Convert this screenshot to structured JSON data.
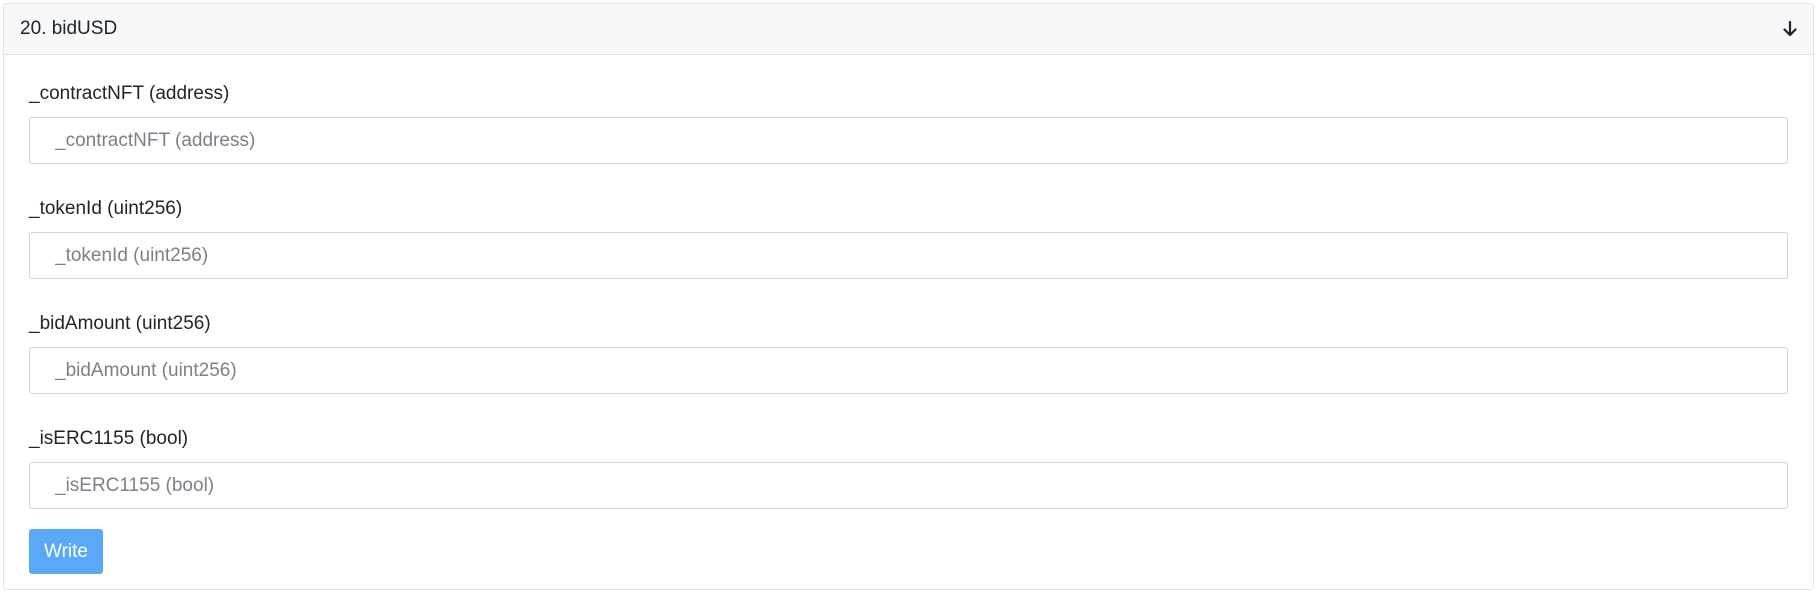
{
  "method": {
    "title": "20. bidUSD",
    "expand_icon": "arrow-down-icon"
  },
  "fields": [
    {
      "label": "_contractNFT (address)",
      "placeholder": "_contractNFT (address)",
      "value": ""
    },
    {
      "label": "_tokenId (uint256)",
      "placeholder": "_tokenId (uint256)",
      "value": ""
    },
    {
      "label": "_bidAmount (uint256)",
      "placeholder": "_bidAmount (uint256)",
      "value": ""
    },
    {
      "label": "_isERC1155 (bool)",
      "placeholder": "_isERC1155 (bool)",
      "value": ""
    }
  ],
  "actions": {
    "write_label": "Write"
  },
  "colors": {
    "button_bg": "#5aa9f8",
    "header_bg": "#f7f8f9",
    "border": "#dfe2e6"
  }
}
